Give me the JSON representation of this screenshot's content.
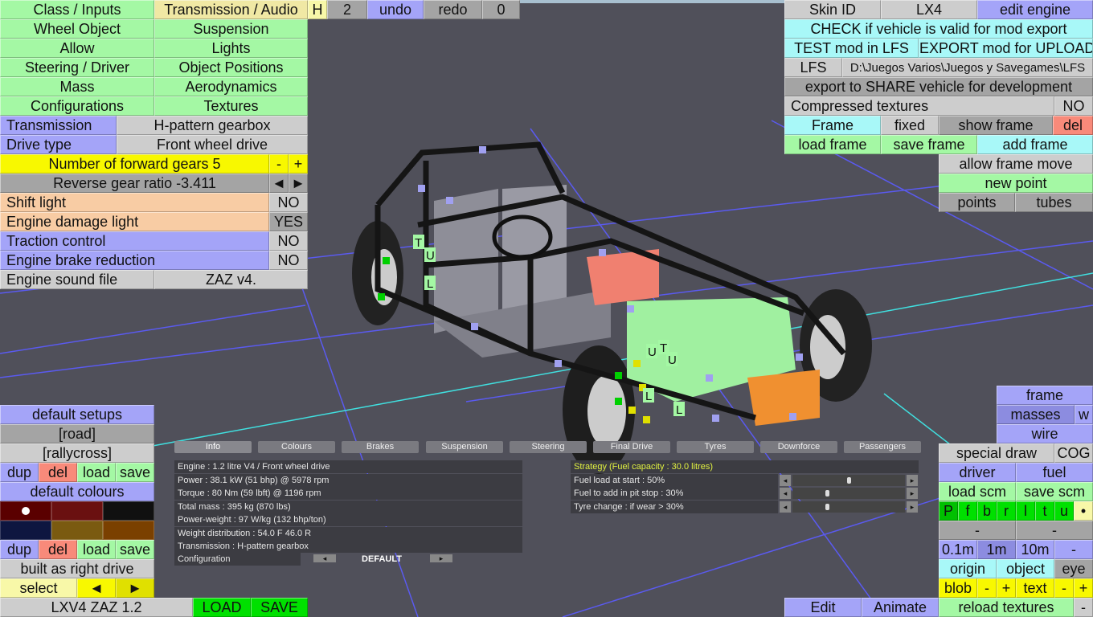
{
  "top": {
    "class_inputs": "Class / Inputs",
    "transmission_audio": "Transmission / Audio",
    "h": "H",
    "two": "2",
    "undo": "undo",
    "redo": "redo",
    "zero": "0"
  },
  "menu": {
    "wheel_object": "Wheel Object",
    "suspension": "Suspension",
    "allow": "Allow",
    "lights": "Lights",
    "steering_driver": "Steering / Driver",
    "object_positions": "Object Positions",
    "mass": "Mass",
    "aerodynamics": "Aerodynamics",
    "configurations": "Configurations",
    "textures": "Textures"
  },
  "transmission": {
    "label": "Transmission",
    "value": "H-pattern gearbox",
    "drive_label": "Drive type",
    "drive_value": "Front wheel drive",
    "gears": "Number of forward gears 5",
    "minus": "-",
    "plus": "+",
    "reverse": "Reverse gear ratio -3.411",
    "left": "◄",
    "right": "►",
    "shift_light": "Shift light",
    "shift_light_val": "NO",
    "damage_light": "Engine damage light",
    "damage_light_val": "YES",
    "traction": "Traction control",
    "traction_val": "NO",
    "brake_red": "Engine brake reduction",
    "brake_red_val": "NO",
    "sound_label": "Engine sound file",
    "sound_val": "ZAZ v4."
  },
  "right": {
    "skin_id": "Skin ID",
    "skin_val": "LX4",
    "edit_engine": "edit engine",
    "check": "CHECK if vehicle is valid for mod export",
    "test": "TEST mod in LFS",
    "export": "EXPORT mod for UPLOAD",
    "lfs": "LFS",
    "path": "D:\\Juegos Varios\\Juegos y Savegames\\LFS",
    "share": "export to SHARE vehicle for development",
    "compressed": "Compressed textures",
    "compressed_val": "NO",
    "frame": "Frame",
    "fixed": "fixed",
    "show_frame": "show frame",
    "del": "del",
    "load_frame": "load frame",
    "save_frame": "save frame",
    "add_frame": "add frame",
    "allow_move": "allow frame move",
    "new_point": "new point",
    "points": "points",
    "tubes": "tubes"
  },
  "view": {
    "frame": "frame",
    "masses": "masses",
    "w": "w",
    "wire": "wire",
    "special_draw": "special draw",
    "cog": "COG",
    "driver": "driver",
    "fuel": "fuel",
    "load_scm": "load scm",
    "save_scm": "save scm",
    "toggles": [
      "P",
      "f",
      "b",
      "r",
      "l",
      "t",
      "u",
      "•"
    ],
    "dash1": "-",
    "dash2": "-",
    "m01": "0.1m",
    "m1": "1m",
    "m10": "10m",
    "mdash": "-",
    "origin": "origin",
    "object": "object",
    "eye": "eye",
    "blob": "blob",
    "blob_minus": "-",
    "blob_plus": "+",
    "text": "text",
    "text_minus": "-",
    "text_plus": "+",
    "reload": "reload textures",
    "reload_minus": "-",
    "edit": "Edit",
    "animate": "Animate"
  },
  "setups": {
    "default_setups": "default setups",
    "road": "[road]",
    "rallycross": "[rallycross]",
    "dup": "dup",
    "del": "del",
    "load": "load",
    "save": "save",
    "default_colours": "default colours",
    "colours": [
      "#5a0000",
      "#6a1010",
      "#101010",
      "#0e1640",
      "#7a5a10",
      "#7a4000"
    ],
    "dup2": "dup",
    "del2": "del",
    "load2": "load",
    "save2": "save",
    "right_drive": "built as right drive",
    "select": "select",
    "prev": "◄",
    "next": "►",
    "car_name": "LXV4 ZAZ 1.2",
    "load_btn": "LOAD",
    "save_btn": "SAVE"
  },
  "info": {
    "tabs": [
      "Info",
      "Colours",
      "Brakes",
      "Suspension",
      "Steering",
      "Final Drive",
      "Tyres",
      "Downforce",
      "Passengers"
    ],
    "rows": [
      "Engine : 1.2 litre V4 / Front wheel drive",
      "Power : 38.1 kW (51 bhp) @ 5978 rpm",
      "Torque : 80 Nm (59 lbft) @ 1196 rpm",
      "Total mass : 395 kg (870 lbs)",
      "Power-weight : 97 W/kg (132 bhp/ton)",
      "Weight distribution : 54.0 F  46.0 R",
      "Transmission : H-pattern gearbox"
    ],
    "config_label": "Configuration",
    "config_value": "DEFAULT",
    "strategy": "Strategy (Fuel capacity : 30.0 litres)",
    "sliders": [
      {
        "label": "Fuel load at start : 50%",
        "value": 50
      },
      {
        "label": "Fuel to add in pit stop : 30%",
        "value": 30
      },
      {
        "label": "Tyre change : if wear > 30%",
        "value": 30
      }
    ]
  },
  "markers": [
    "T",
    "U",
    "L",
    "U",
    "T",
    "U",
    "L",
    "L"
  ]
}
